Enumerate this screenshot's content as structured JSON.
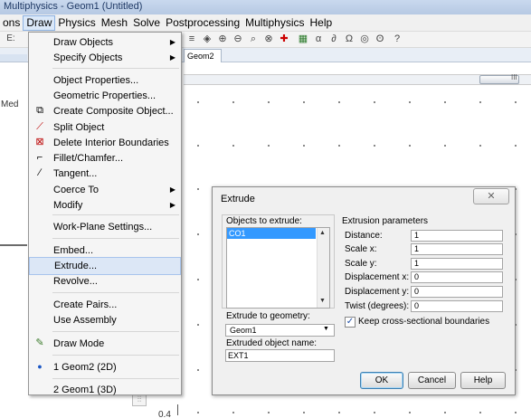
{
  "window": {
    "title": "Multiphysics - Geom1 (Untitled)"
  },
  "menubar": [
    "ons",
    "Draw",
    "Physics",
    "Mesh",
    "Solve",
    "Postprocessing",
    "Multiphysics",
    "Help"
  ],
  "tabs": {
    "geom2": "Geom2"
  },
  "left": {
    "label": "Med",
    "toolbar_glyph": "E:"
  },
  "axis": {
    "value": "0.4"
  },
  "draw_menu": {
    "items": [
      {
        "label": "Draw Objects",
        "submenu": true
      },
      {
        "label": "Specify Objects",
        "submenu": true
      },
      {
        "label": "Object Properties..."
      },
      {
        "label": "Geometric Properties..."
      },
      {
        "label": "Create Composite Object..."
      },
      {
        "label": "Split Object"
      },
      {
        "label": "Delete Interior Boundaries"
      },
      {
        "label": "Fillet/Chamfer..."
      },
      {
        "label": "Tangent..."
      },
      {
        "label": "Coerce To",
        "submenu": true
      },
      {
        "label": "Modify",
        "submenu": true
      },
      {
        "label": "Work-Plane Settings..."
      },
      {
        "label": "Embed..."
      },
      {
        "label": "Extrude..."
      },
      {
        "label": "Revolve..."
      },
      {
        "label": "Create Pairs..."
      },
      {
        "label": "Use Assembly"
      },
      {
        "label": "Draw Mode"
      },
      {
        "label": "1 Geom2 (2D)"
      },
      {
        "label": "2 Geom1 (3D)"
      }
    ],
    "highlighted": "Extrude..."
  },
  "dialog": {
    "title": "Extrude",
    "objects_label": "Objects to extrude:",
    "objects": [
      "CO1"
    ],
    "params_label": "Extrusion parameters",
    "params": [
      {
        "label": "Distance:",
        "value": "1"
      },
      {
        "label": "Scale x:",
        "value": "1"
      },
      {
        "label": "Scale y:",
        "value": "1"
      },
      {
        "label": "Displacement x:",
        "value": "0"
      },
      {
        "label": "Displacement y:",
        "value": "0"
      },
      {
        "label": "Twist (degrees):",
        "value": "0"
      }
    ],
    "keep_label": "Keep cross-sectional boundaries",
    "keep_checked": true,
    "extrude_to_label": "Extrude to geometry:",
    "extrude_to_value": "Geom1",
    "name_label": "Extruded object name:",
    "name_value": "EXT1",
    "ok": "OK",
    "cancel": "Cancel",
    "help": "Help"
  }
}
